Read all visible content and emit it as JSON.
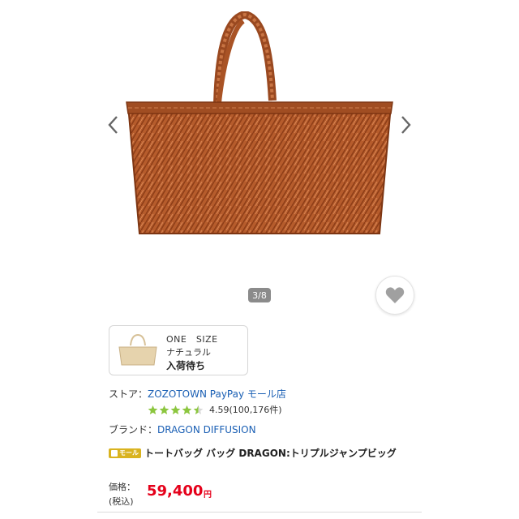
{
  "gallery": {
    "counter": "3/8",
    "icons": {
      "prev": "chevron-left-icon",
      "next": "chevron-right-icon",
      "favorite": "heart-icon"
    },
    "bag_color": "#b65c2c"
  },
  "variant": {
    "size": "ONE　SIZE",
    "color": "ナチュラル",
    "status": "入荷待ち"
  },
  "store": {
    "label": "ストア：",
    "name": "ZOZOTOWN PayPay モール店",
    "rating": "4.59(100,176件)",
    "stars": 4.5,
    "star_color": "#8cc63f"
  },
  "brand": {
    "label": "ブランド：",
    "name": "DRAGON DIFFUSION"
  },
  "product": {
    "badge": "モール",
    "title": "トートバッグ バッグ DRAGON:トリプルジャンプビッグ"
  },
  "price": {
    "label1": "価格：",
    "label2": "(税込)",
    "value": "59,400",
    "unit": "円",
    "color": "#e5001a"
  }
}
